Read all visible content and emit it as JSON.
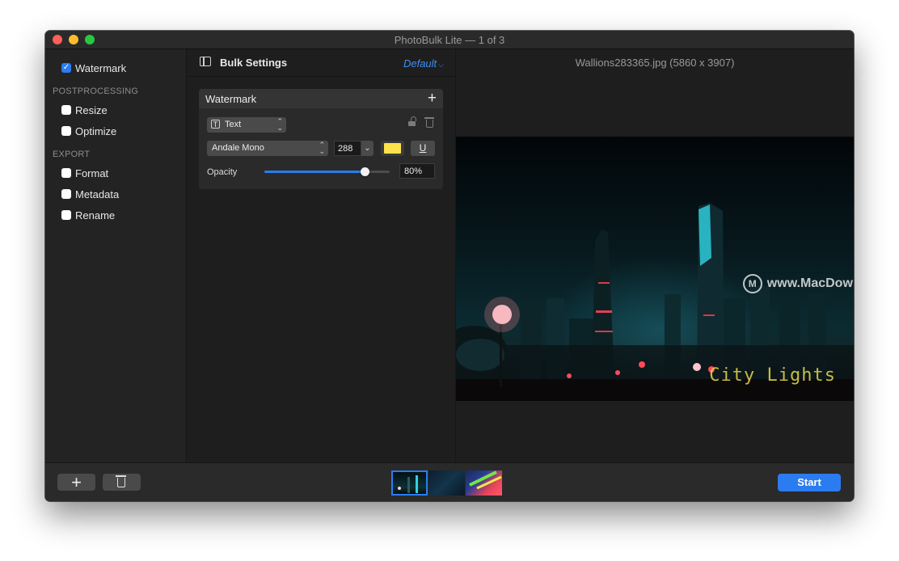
{
  "window": {
    "title": "PhotoBulk Lite — 1 of 3"
  },
  "sidebar": {
    "watermark": {
      "label": "Watermark",
      "checked": true
    },
    "postprocessing_label": "POSTPROCESSING",
    "postprocessing_items": [
      {
        "label": "Resize",
        "checked": false
      },
      {
        "label": "Optimize",
        "checked": false
      }
    ],
    "export_label": "EXPORT",
    "export_items": [
      {
        "label": "Format",
        "checked": false
      },
      {
        "label": "Metadata",
        "checked": false
      },
      {
        "label": "Rename",
        "checked": false
      }
    ]
  },
  "settings": {
    "title": "Bulk Settings",
    "preset": "Default",
    "card": {
      "title": "Watermark",
      "type_label": "Text",
      "font": "Andale Mono",
      "font_size": "288",
      "text_color": "#ffe34a",
      "underline_label": "U",
      "opacity_label": "Opacity",
      "opacity_value": "80%",
      "opacity_fraction": 0.8
    }
  },
  "preview": {
    "filename": "Wallions283365.jpg (5860 x 3907)",
    "watermark_text": "City Lights",
    "watermark_color": "#e8d94a",
    "site_watermark": "www.MacDown.com"
  },
  "bottombar": {
    "start_label": "Start",
    "accent": "#2b7cf0"
  }
}
